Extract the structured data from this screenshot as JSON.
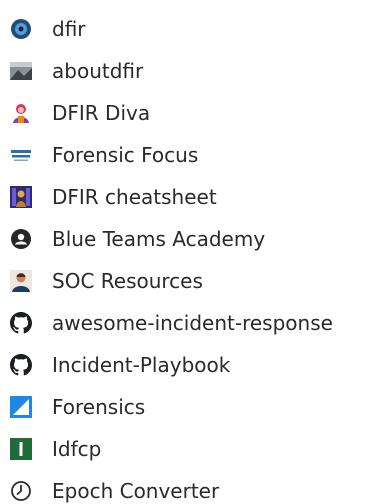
{
  "bookmarks": [
    {
      "label": "dfir",
      "icon": "dfir-logo-icon"
    },
    {
      "label": "aboutdfir",
      "icon": "aboutdfir-icon"
    },
    {
      "label": "DFIR Diva",
      "icon": "dfir-diva-icon"
    },
    {
      "label": "Forensic Focus",
      "icon": "forensic-focus-icon"
    },
    {
      "label": "DFIR cheatsheet",
      "icon": "dfir-cheatsheet-icon"
    },
    {
      "label": "Blue Teams Academy",
      "icon": "blue-teams-academy-icon"
    },
    {
      "label": "SOC Resources",
      "icon": "soc-resources-icon"
    },
    {
      "label": "awesome-incident-response",
      "icon": "github-icon"
    },
    {
      "label": "Incident-Playbook",
      "icon": "github-icon"
    },
    {
      "label": "Forensics",
      "icon": "forensics-icon"
    },
    {
      "label": "Idfcp",
      "icon": "idfcp-icon"
    },
    {
      "label": "Epoch Converter",
      "icon": "clock-icon"
    }
  ]
}
